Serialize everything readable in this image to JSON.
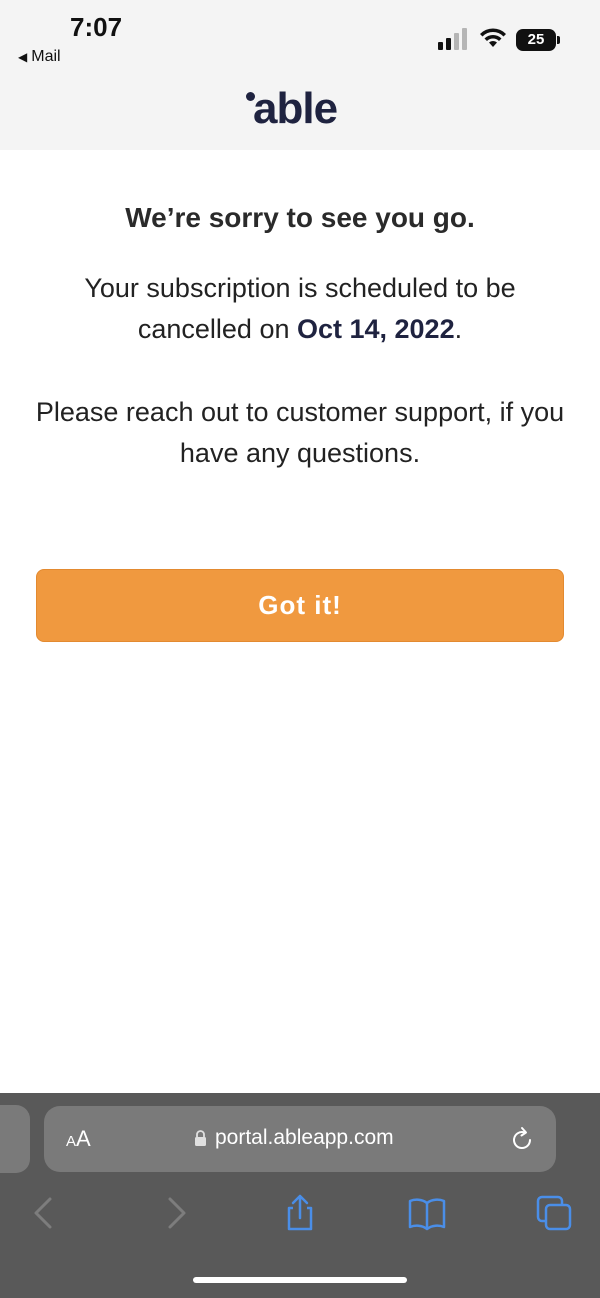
{
  "status_bar": {
    "time": "7:07",
    "back_app": "Mail",
    "battery": "25"
  },
  "header": {
    "logo_text": "able"
  },
  "main": {
    "title": "We’re sorry to see you go.",
    "message_before_date": "Your subscription is scheduled to be cancelled on ",
    "cancel_date": "Oct 14, 2022",
    "message_after_date": ".",
    "support_message": "Please reach out to customer support, if you have any questions.",
    "button_label": "Got it!"
  },
  "browser": {
    "text_size_label_small": "A",
    "text_size_label_large": "A",
    "url": "portal.ableapp.com"
  },
  "colors": {
    "accent": "#f0993f",
    "brand_navy": "#1f2340",
    "toolbar_bg": "#595959",
    "toolbar_icon": "#4a8ee8"
  }
}
